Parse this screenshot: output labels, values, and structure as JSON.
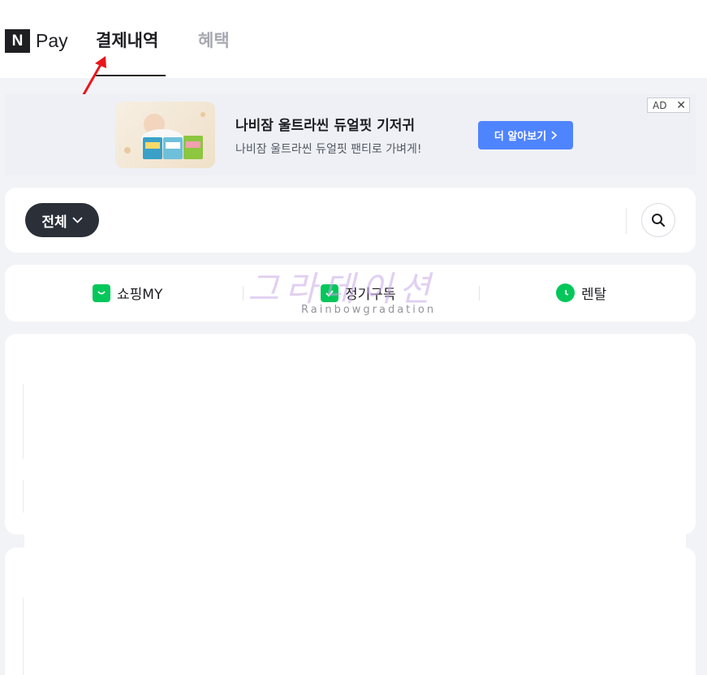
{
  "header": {
    "logo_mark": "N",
    "logo_text": "Pay",
    "tabs": [
      {
        "label": "결제내역",
        "active": true
      },
      {
        "label": "혜택",
        "active": false
      }
    ]
  },
  "ad": {
    "title": "나비잠 울트라씬 듀얼핏 기저귀",
    "subtitle": "나비잠 울트라씬 듀얼핏 팬티로 가벼게!",
    "button_label": "더 알아보기",
    "button_icon": "chevron-right-icon",
    "badge_label": "AD",
    "badge_close": "✕",
    "button_color": "#4f84ff"
  },
  "filter": {
    "selected": "전체",
    "dropdown_icon": "chevron-down-icon",
    "search_icon": "search-icon"
  },
  "services": [
    {
      "label": "쇼핑MY",
      "icon": "shopping-bag-icon"
    },
    {
      "label": "정기구독",
      "icon": "check-box-icon"
    },
    {
      "label": "렌탈",
      "icon": "clock-icon"
    }
  ],
  "watermark": {
    "main": "그라데이션",
    "sub": "Rainbowgradation"
  },
  "colors": {
    "brand_green": "#03c75a",
    "dark": "#1e1e23",
    "annotation_red": "#e8161b"
  }
}
